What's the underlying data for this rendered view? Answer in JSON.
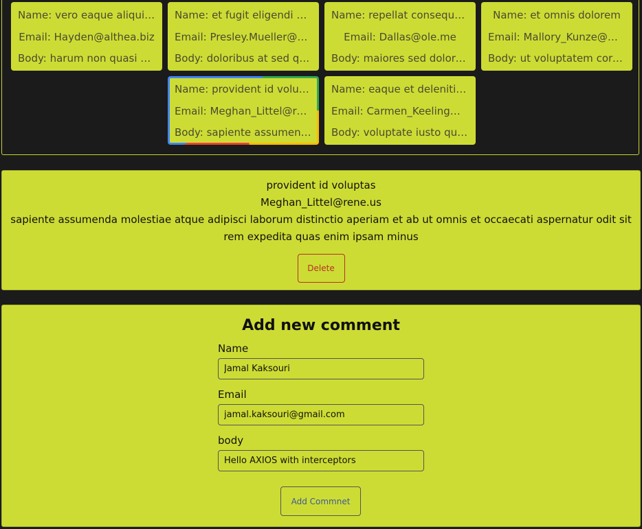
{
  "comments": [
    {
      "name": "Name: vero eaque aliquid doloribus et culpa",
      "email": "Email: Hayden@althea.biz",
      "body": "Body: harum non quasi et ratione"
    },
    {
      "name": "Name: et fugit eligendi deleniti quidem",
      "email": "Email: Presley.Mueller@myrl.com",
      "body": "Body: doloribus at sed quis culpa"
    },
    {
      "name": "Name: repellat consequatur praesentium",
      "email": "Email: Dallas@ole.me",
      "body": "Body: maiores sed dolores similique"
    },
    {
      "name": "Name: et omnis dolorem",
      "email": "Email: Mallory_Kunze@marie.org",
      "body": "Body: ut voluptatem corrupti velit"
    },
    {
      "name": "Name: provident id voluptas",
      "email": "Email: Meghan_Littel@rene.us",
      "body": "Body: sapiente assumenda molestiae"
    },
    {
      "name": "Name: eaque et deleniti atque tenetur",
      "email": "Email: Carmen_Keeling@caroline.name",
      "body": "Body: voluptate iusto quis nobis"
    }
  ],
  "detail": {
    "name": "provident id voluptas",
    "email": "Meghan_Littel@rene.us",
    "body": "sapiente assumenda molestiae atque adipisci laborum distinctio aperiam et ab ut omnis et occaecati aspernatur odit sit rem expedita quas enim ipsam minus",
    "delete_label": "Delete"
  },
  "form": {
    "title": "Add new comment",
    "name_label": "Name",
    "name_value": "Jamal Kaksouri",
    "email_label": "Email",
    "email_value": "jamal.kaksouri@gmail.com",
    "body_label": "body",
    "body_value": "Hello AXIOS with interceptors",
    "submit_label": "Add Commnet"
  },
  "colors": {
    "page_background": "#1b1b1b",
    "card_background": "#cddc34",
    "delete_accent": "#b5302a",
    "button_text": "#3c5a9a"
  }
}
